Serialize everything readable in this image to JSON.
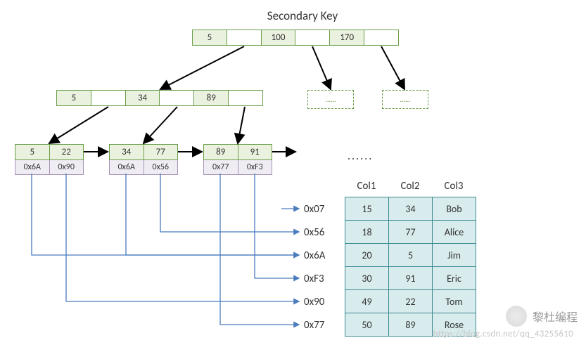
{
  "title": "Secondary Key",
  "root": {
    "keys": [
      "5",
      "100",
      "170"
    ]
  },
  "mid": {
    "keys": [
      "5",
      "34",
      "89"
    ]
  },
  "ghost_label": "......",
  "leaves": [
    {
      "keys": [
        "5",
        "22"
      ],
      "addrs": [
        "0x6A",
        "0x90"
      ]
    },
    {
      "keys": [
        "34",
        "77"
      ],
      "addrs": [
        "0x6A",
        "0x56"
      ]
    },
    {
      "keys": [
        "89",
        "91"
      ],
      "addrs": [
        "0x77",
        "0xF3"
      ]
    }
  ],
  "leaf_dots": "......",
  "row_labels": [
    "0x07",
    "0x56",
    "0x6A",
    "0xF3",
    "0x90",
    "0x77"
  ],
  "table": {
    "headers": [
      "Col1",
      "Col2",
      "Col3"
    ],
    "rows": [
      [
        "15",
        "34",
        "Bob"
      ],
      [
        "18",
        "77",
        "Alice"
      ],
      [
        "20",
        "5",
        "Jim"
      ],
      [
        "30",
        "91",
        "Eric"
      ],
      [
        "49",
        "22",
        "Tom"
      ],
      [
        "50",
        "89",
        "Rose"
      ]
    ]
  },
  "watermark_name": "黎杜编程",
  "watermark_url": "https://blog.csdn.net/qq_43255610"
}
